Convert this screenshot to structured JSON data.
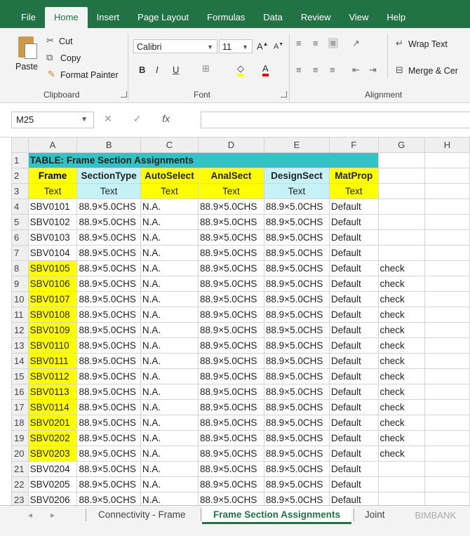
{
  "ribbon_tabs": [
    {
      "label": "File"
    },
    {
      "label": "Home"
    },
    {
      "label": "Insert"
    },
    {
      "label": "Page Layout"
    },
    {
      "label": "Formulas"
    },
    {
      "label": "Data"
    },
    {
      "label": "Review"
    },
    {
      "label": "View"
    },
    {
      "label": "Help"
    }
  ],
  "active_tab": "Home",
  "clipboard": {
    "paste": "Paste",
    "cut": "Cut",
    "copy": "Copy",
    "format_painter": "Format Painter",
    "group_label": "Clipboard"
  },
  "font": {
    "name": "Calibri",
    "size": "11",
    "bold": "B",
    "italic": "I",
    "underline": "U",
    "group_label": "Font"
  },
  "alignment": {
    "wrap_text": "Wrap Text",
    "merge_center": "Merge & Cer",
    "group_label": "Alignment"
  },
  "formula_bar": {
    "name_box": "M25",
    "fx": "fx",
    "formula": ""
  },
  "columns": [
    "A",
    "B",
    "C",
    "D",
    "E",
    "F",
    "G",
    "H"
  ],
  "table": {
    "title": "TABLE:  Frame Section Assignments",
    "headers": [
      "Frame",
      "SectionType",
      "AutoSelect",
      "AnalSect",
      "DesignSect",
      "MatProp"
    ],
    "units": [
      "Text",
      "Text",
      "Text",
      "Text",
      "Text",
      "Text"
    ],
    "rows": [
      {
        "n": "4",
        "frame": "SBV0101",
        "section": "88.9×5.0CHS",
        "auto": "N.A.",
        "anal": "88.9×5.0CHS",
        "design": "88.9×5.0CHS",
        "mat": "Default",
        "g": ""
      },
      {
        "n": "5",
        "frame": "SBV0102",
        "section": "88.9×5.0CHS",
        "auto": "N.A.",
        "anal": "88.9×5.0CHS",
        "design": "88.9×5.0CHS",
        "mat": "Default",
        "g": ""
      },
      {
        "n": "6",
        "frame": "SBV0103",
        "section": "88.9×5.0CHS",
        "auto": "N.A.",
        "anal": "88.9×5.0CHS",
        "design": "88.9×5.0CHS",
        "mat": "Default",
        "g": ""
      },
      {
        "n": "7",
        "frame": "SBV0104",
        "section": "88.9×5.0CHS",
        "auto": "N.A.",
        "anal": "88.9×5.0CHS",
        "design": "88.9×5.0CHS",
        "mat": "Default",
        "g": ""
      },
      {
        "n": "8",
        "frame": "SBV0105",
        "section": "88.9×5.0CHS",
        "auto": "N.A.",
        "anal": "88.9×5.0CHS",
        "design": "88.9×5.0CHS",
        "mat": "Default",
        "g": "check"
      },
      {
        "n": "9",
        "frame": "SBV0106",
        "section": "88.9×5.0CHS",
        "auto": "N.A.",
        "anal": "88.9×5.0CHS",
        "design": "88.9×5.0CHS",
        "mat": "Default",
        "g": "check"
      },
      {
        "n": "10",
        "frame": "SBV0107",
        "section": "88.9×5.0CHS",
        "auto": "N.A.",
        "anal": "88.9×5.0CHS",
        "design": "88.9×5.0CHS",
        "mat": "Default",
        "g": "check"
      },
      {
        "n": "11",
        "frame": "SBV0108",
        "section": "88.9×5.0CHS",
        "auto": "N.A.",
        "anal": "88.9×5.0CHS",
        "design": "88.9×5.0CHS",
        "mat": "Default",
        "g": "check"
      },
      {
        "n": "12",
        "frame": "SBV0109",
        "section": "88.9×5.0CHS",
        "auto": "N.A.",
        "anal": "88.9×5.0CHS",
        "design": "88.9×5.0CHS",
        "mat": "Default",
        "g": "check"
      },
      {
        "n": "13",
        "frame": "SBV0110",
        "section": "88.9×5.0CHS",
        "auto": "N.A.",
        "anal": "88.9×5.0CHS",
        "design": "88.9×5.0CHS",
        "mat": "Default",
        "g": "check"
      },
      {
        "n": "14",
        "frame": "SBV0111",
        "section": "88.9×5.0CHS",
        "auto": "N.A.",
        "anal": "88.9×5.0CHS",
        "design": "88.9×5.0CHS",
        "mat": "Default",
        "g": "check"
      },
      {
        "n": "15",
        "frame": "SBV0112",
        "section": "88.9×5.0CHS",
        "auto": "N.A.",
        "anal": "88.9×5.0CHS",
        "design": "88.9×5.0CHS",
        "mat": "Default",
        "g": "check"
      },
      {
        "n": "16",
        "frame": "SBV0113",
        "section": "88.9×5.0CHS",
        "auto": "N.A.",
        "anal": "88.9×5.0CHS",
        "design": "88.9×5.0CHS",
        "mat": "Default",
        "g": "check"
      },
      {
        "n": "17",
        "frame": "SBV0114",
        "section": "88.9×5.0CHS",
        "auto": "N.A.",
        "anal": "88.9×5.0CHS",
        "design": "88.9×5.0CHS",
        "mat": "Default",
        "g": "check"
      },
      {
        "n": "18",
        "frame": "SBV0201",
        "section": "88.9×5.0CHS",
        "auto": "N.A.",
        "anal": "88.9×5.0CHS",
        "design": "88.9×5.0CHS",
        "mat": "Default",
        "g": "check"
      },
      {
        "n": "19",
        "frame": "SBV0202",
        "section": "88.9×5.0CHS",
        "auto": "N.A.",
        "anal": "88.9×5.0CHS",
        "design": "88.9×5.0CHS",
        "mat": "Default",
        "g": "check"
      },
      {
        "n": "20",
        "frame": "SBV0203",
        "section": "88.9×5.0CHS",
        "auto": "N.A.",
        "anal": "88.9×5.0CHS",
        "design": "88.9×5.0CHS",
        "mat": "Default",
        "g": "check"
      },
      {
        "n": "21",
        "frame": "SBV0204",
        "section": "88.9×5.0CHS",
        "auto": "N.A.",
        "anal": "88.9×5.0CHS",
        "design": "88.9×5.0CHS",
        "mat": "Default",
        "g": ""
      },
      {
        "n": "22",
        "frame": "SBV0205",
        "section": "88.9×5.0CHS",
        "auto": "N.A.",
        "anal": "88.9×5.0CHS",
        "design": "88.9×5.0CHS",
        "mat": "Default",
        "g": ""
      },
      {
        "n": "23",
        "frame": "SBV0206",
        "section": "88.9×5.0CHS",
        "auto": "N.A.",
        "anal": "88.9×5.0CHS",
        "design": "88.9×5.0CHS",
        "mat": "Default",
        "g": ""
      }
    ],
    "highlighted_rows": [
      "8",
      "9",
      "10",
      "11",
      "12",
      "13",
      "14",
      "15",
      "16",
      "17",
      "18",
      "19",
      "20"
    ]
  },
  "sheet_tabs": [
    {
      "label": "Connectivity - Frame",
      "active": false
    },
    {
      "label": "Frame Section Assignments",
      "active": true
    },
    {
      "label": "Joint",
      "active": false
    }
  ],
  "watermark": "BIMBANK",
  "colors": {
    "ribbon_green": "#217346",
    "title_cyan": "#33c3c5",
    "header_yellow": "#ffff00",
    "header_lightblue": "#c6f2f7"
  }
}
